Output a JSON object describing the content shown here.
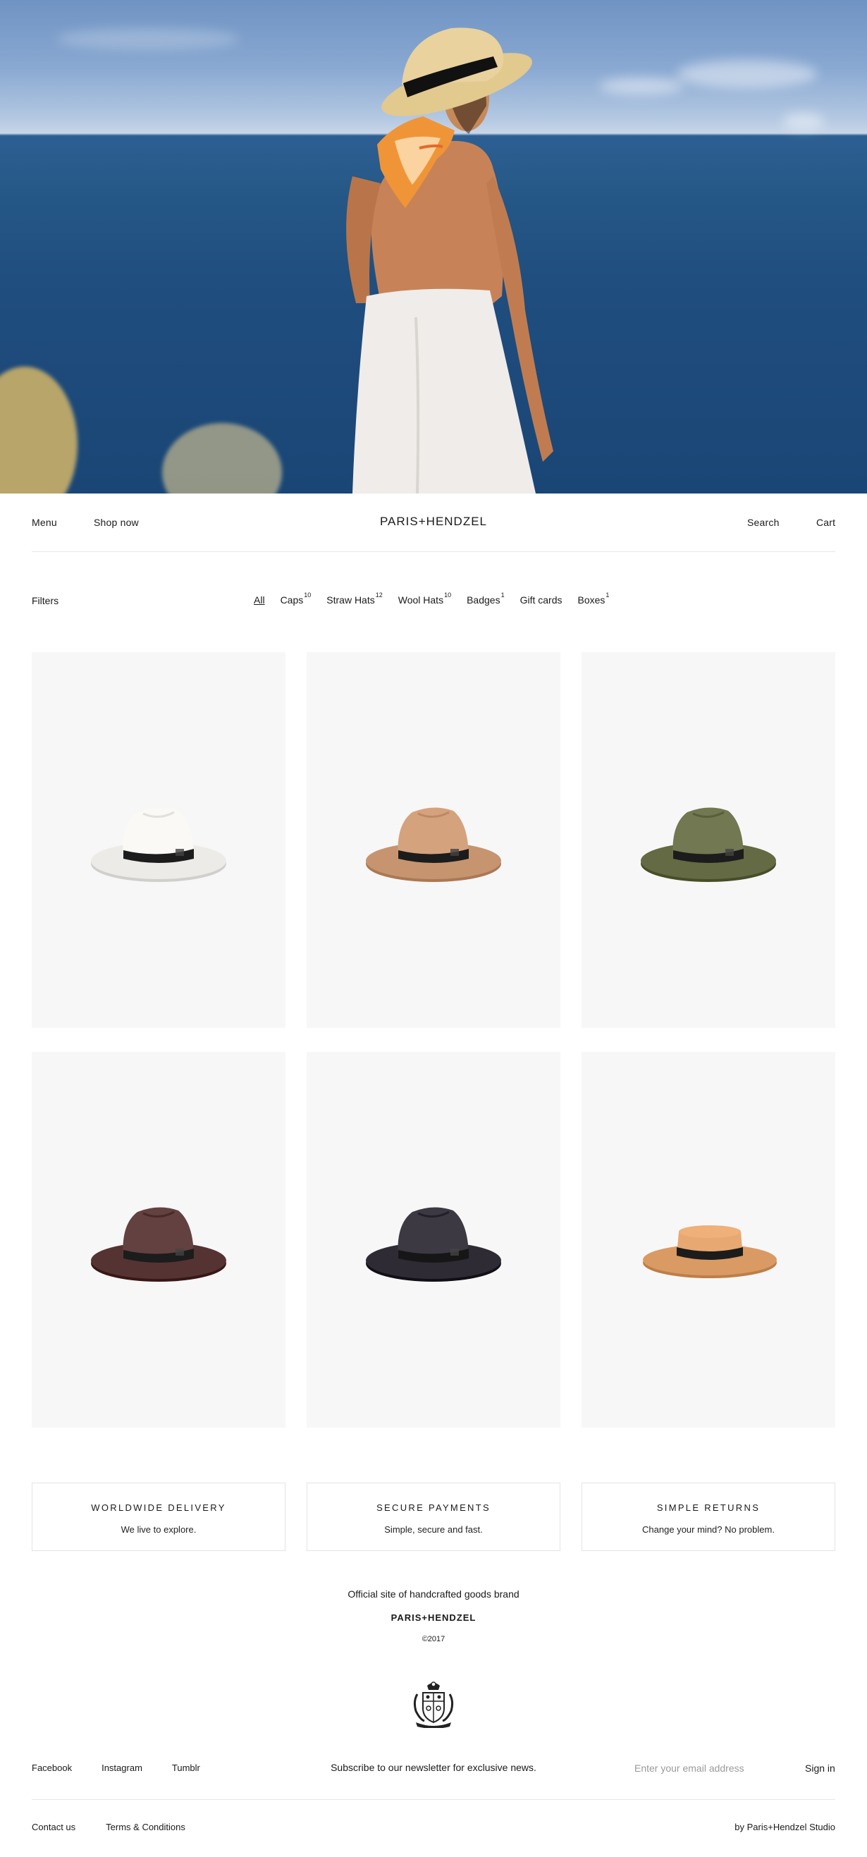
{
  "header": {
    "menu": "Menu",
    "shop_now": "Shop now",
    "logo": "PARIS+HENDZEL",
    "search": "Search",
    "cart": "Cart"
  },
  "filters": {
    "label": "Filters",
    "categories": [
      {
        "label": "All",
        "count": ""
      },
      {
        "label": "Caps",
        "count": "10"
      },
      {
        "label": "Straw Hats",
        "count": "12"
      },
      {
        "label": "Wool Hats",
        "count": "10"
      },
      {
        "label": "Badges",
        "count": "1"
      },
      {
        "label": "Gift cards",
        "count": ""
      },
      {
        "label": "Boxes",
        "count": "1"
      }
    ],
    "active": "All"
  },
  "products": [
    {
      "name": "fedora-hat",
      "color": "#ecebe8",
      "band": "#1c1c1c"
    },
    {
      "name": "fedora-hat",
      "color": "#c79470",
      "band": "#1c1c1c"
    },
    {
      "name": "fedora-hat",
      "color": "#636a44",
      "band": "#1c1c1c"
    },
    {
      "name": "fedora-hat",
      "color": "#553332",
      "band": "#1c1c1c"
    },
    {
      "name": "fedora-hat",
      "color": "#2e2b34",
      "band": "#161616"
    },
    {
      "name": "boater-hat",
      "color": "#d99a63",
      "band": "#1c1c1c"
    }
  ],
  "features": [
    {
      "title": "WORLDWIDE DELIVERY",
      "subtitle": "We live to explore."
    },
    {
      "title": "SECURE PAYMENTS",
      "subtitle": "Simple, secure and fast."
    },
    {
      "title": "SIMPLE RETURNS",
      "subtitle": "Change your mind? No problem."
    }
  ],
  "footer": {
    "official": "Official site of handcrafted goods brand",
    "brand": "PARIS+HENDZEL",
    "copyright": "©2017",
    "socials": [
      "Facebook",
      "Instagram",
      "Tumblr"
    ],
    "newsletter": "Subscribe to our newsletter for exclusive news.",
    "email_placeholder": "Enter your email address",
    "sign_in": "Sign in",
    "contact": "Contact us",
    "terms": "Terms & Conditions",
    "studio": "by Paris+Hendzel Studio"
  }
}
